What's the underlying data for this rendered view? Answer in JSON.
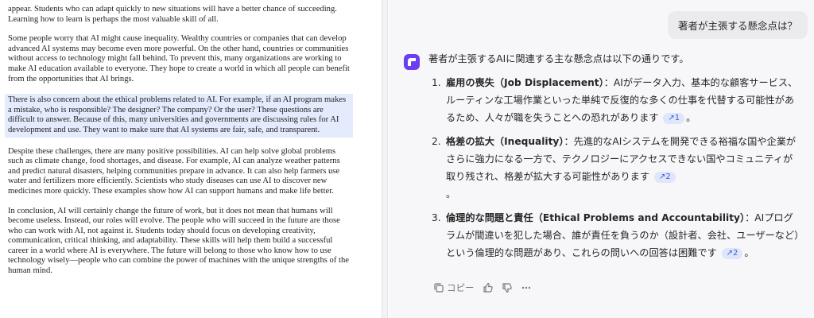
{
  "document": {
    "paragraphs": [
      "appear. Students who can adapt quickly to new situations will have a better chance of succeeding. Learning how to learn is perhaps the most valuable skill of all.",
      "Some people worry that AI might cause inequality. Wealthy countries or companies that can develop advanced AI systems may become even more powerful. On the other hand, countries or communities without access to technology might fall behind. To prevent this, many organizations are working to make AI education available to everyone. They hope to create a world in which all people can benefit from the opportunities that AI brings.",
      "There is also concern about the ethical problems related to AI. For example, if an AI program makes a mistake, who is responsible? The designer? The company? Or the user? These questions are difficult to answer. Because of this, many universities and governments are discussing rules for AI development and use. They want to make sure that AI systems are fair, safe, and transparent.",
      "Despite these challenges, there are many positive possibilities. AI can help solve global problems such as climate change, food shortages, and disease. For example, AI can analyze weather patterns and predict natural disasters, helping communities prepare in advance. It can also help farmers use water and fertilizers more efficiently. Scientists who study diseases can use AI to discover new medicines more quickly. These examples show how AI can support humans and make life better.",
      "In conclusion, AI will certainly change the future of work, but it does not mean that humans will become useless. Instead, our roles will evolve. The people who will succeed in the future are those who can work with AI, not against it. Students today should focus on developing creativity, communication, critical thinking, and adaptability. These skills will help them build a successful career in a world where AI is everywhere. The future will belong to those who know how to use technology wisely—people who can combine the power of machines with the unique strengths of the human mind."
    ]
  },
  "chat": {
    "user_message": "著者が主張する懸念点は？",
    "answer_intro": "著者が主張するAIに関連する主な懸念点は以下の通りです。",
    "items": [
      {
        "num": "1.",
        "title": "雇用の喪失（Job Displacement）",
        "body": "：AIがデータ入力、基本的な顧客サービス、ルーティンな工場作業といった単純で反復的な多くの仕事を代替する可能性があるため、人々が職を失うことへの恐れがあります",
        "cite": "↗1",
        "end": "。"
      },
      {
        "num": "2.",
        "title": "格差の拡大（Inequality）",
        "body": "：先進的なAIシステムを開発できる裕福な国や企業がさらに強力になる一方で、テクノロジーにアクセスできない国やコミュニティが取り残され、格差が拡大する可能性があります",
        "cite": "↗2",
        "end": "。"
      },
      {
        "num": "3.",
        "title": "倫理的な問題と責任（Ethical Problems and Accountability）",
        "body": "：AIプログラムが間違いを犯した場合、誰が責任を負うのか（設計者、会社、ユーザーなど）という倫理的な問題があり、これらの問いへの回答は困難です",
        "cite": "↗2",
        "end": "。"
      }
    ],
    "actions": {
      "copy_label": "コピー"
    }
  },
  "colors": {
    "highlight": "#e3ebfd",
    "accent": "#6a3ff0",
    "cite_bg": "#dfe6fb",
    "cite_fg": "#3b5bd6"
  },
  "icons": [
    "assistant-logo-icon",
    "copy-icon",
    "thumbs-up-icon",
    "thumbs-down-icon",
    "more-icon"
  ]
}
